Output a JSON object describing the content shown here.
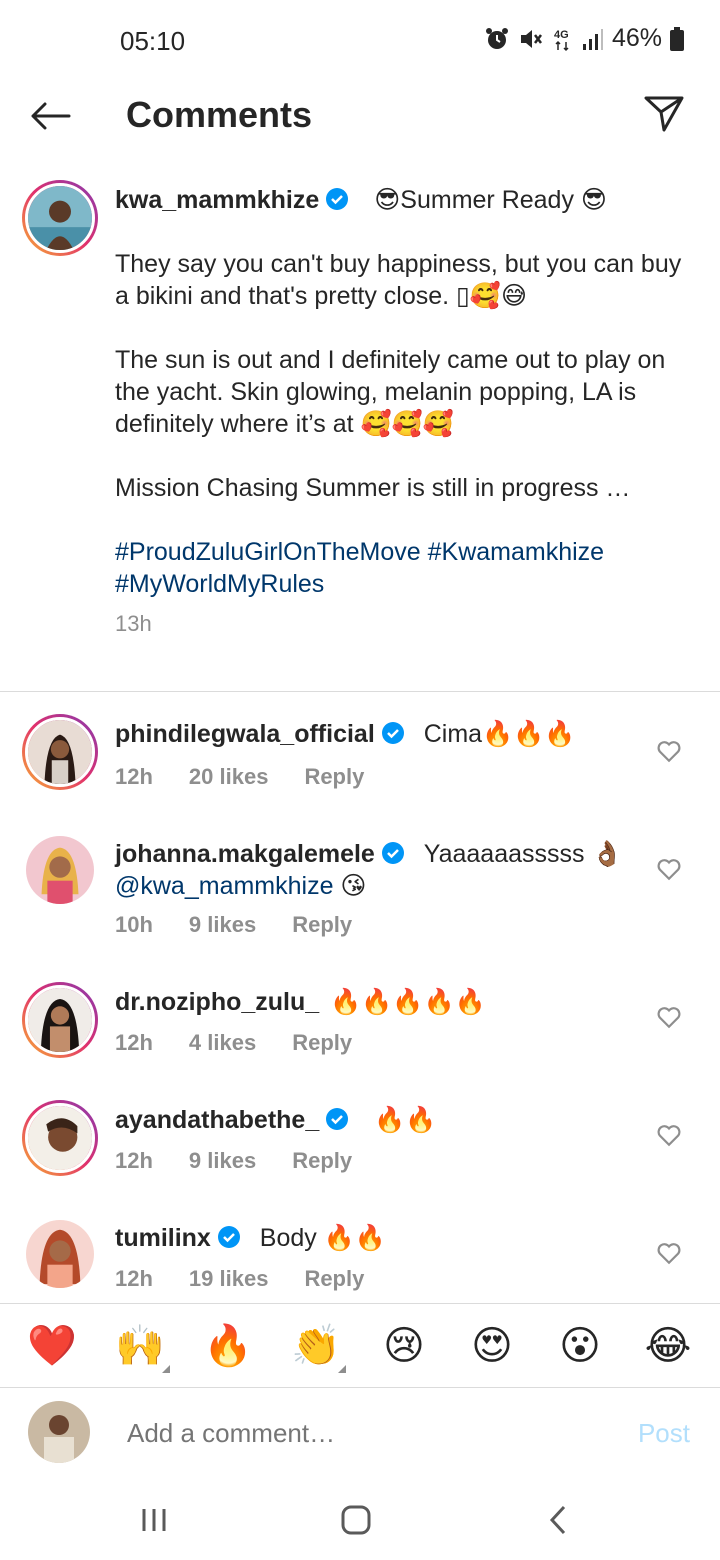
{
  "status_bar": {
    "time": "05:10",
    "network": "4G",
    "battery": "46%",
    "icons": [
      "alarm-icon",
      "mute-icon",
      "network-4g-icon",
      "signal-icon",
      "battery-icon"
    ]
  },
  "header": {
    "title": "Comments",
    "back_icon": "arrow-left-icon",
    "share_icon": "send-icon"
  },
  "caption": {
    "username": "kwa_mammkhize",
    "verified": true,
    "headline": "😎Summer Ready 😎",
    "paragraphs": [
      "They say you can't buy happiness, but you can buy a bikini and that's pretty close. ▯🥰😅",
      "The sun is out and I definitely came out to play on the yacht. Skin glowing, melanin popping, LA is definitely where it’s at 🥰🥰🥰",
      "Mission Chasing Summer is still in progress …"
    ],
    "hashtags": "#ProudZuluGirlOnTheMove #Kwamamkhize #MyWorldMyRules",
    "time": "13h"
  },
  "comments": [
    {
      "username": "phindilegwala_official",
      "verified": true,
      "text": "Cima🔥🔥🔥",
      "mention": "",
      "trail": "",
      "time": "12h",
      "likes": "20 likes",
      "reply": "Reply"
    },
    {
      "username": "johanna.makgalemele",
      "verified": true,
      "text": "Yaaaaaasssss 👌🏾 ",
      "mention": "@kwa_mammkhize",
      "trail": " 😘",
      "time": "10h",
      "likes": "9 likes",
      "reply": "Reply"
    },
    {
      "username": "dr.nozipho_zulu_",
      "verified": false,
      "text": "🔥🔥🔥🔥🔥",
      "mention": "",
      "trail": "",
      "time": "12h",
      "likes": "4 likes",
      "reply": "Reply"
    },
    {
      "username": "ayandathabethe_",
      "verified": true,
      "text": "🔥🔥",
      "mention": "",
      "trail": "",
      "time": "12h",
      "likes": "9 likes",
      "reply": "Reply"
    },
    {
      "username": "tumilinx",
      "verified": true,
      "text": "Body 🔥🔥",
      "mention": "",
      "trail": "",
      "time": "12h",
      "likes": "19 likes",
      "reply": "Reply"
    }
  ],
  "emoji_bar": [
    "❤️",
    "🙌",
    "🔥",
    "👏",
    "😢",
    "😍",
    "😮",
    "😂"
  ],
  "comment_input": {
    "placeholder": "Add a comment…",
    "post_label": "Post"
  },
  "nav_bar": {
    "icons": [
      "recent-apps-icon",
      "home-icon",
      "back-icon"
    ]
  },
  "colors": {
    "link": "#00376b",
    "verified": "#0095f6",
    "meta": "#8e8e8e",
    "post_disabled": "#b2dffc"
  }
}
